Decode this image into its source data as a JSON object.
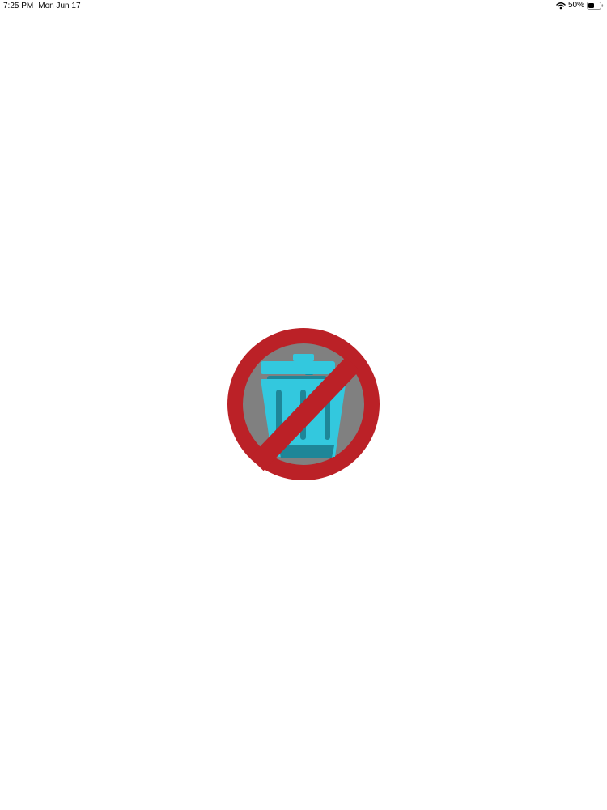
{
  "status_bar": {
    "time": "7:25 PM",
    "date": "Mon Jun 17",
    "battery_percent": "50%",
    "battery_level": 0.5,
    "wifi_icon": "wifi-icon",
    "battery_icon": "battery-icon"
  },
  "splash": {
    "icon": "no-trash-icon",
    "colors": {
      "ring": "#bb2127",
      "background": "#808080",
      "bin": "#33c8de",
      "bin_dark": "#1e8698"
    }
  }
}
